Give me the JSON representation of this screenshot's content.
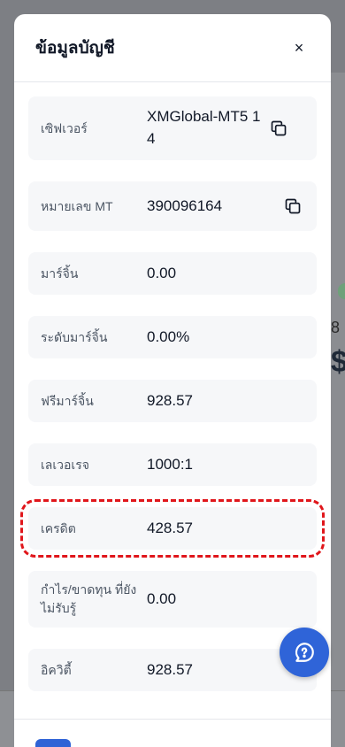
{
  "modal": {
    "title": "ข้อมูลบัญชี",
    "close_label": "×"
  },
  "rows": [
    {
      "label": "เซิฟเวอร์",
      "value": "XMGlobal-MT5 14",
      "copy": true
    },
    {
      "label": "หมายเลข MT",
      "value": "390096164",
      "copy": true
    },
    {
      "label": "มาร์จิ้น",
      "value": "0.00",
      "copy": false
    },
    {
      "label": "ระดับมาร์จิ้น",
      "value": "0.00%",
      "copy": false
    },
    {
      "label": "ฟรีมาร์จิ้น",
      "value": "928.57",
      "copy": false
    },
    {
      "label": "เลเวอเรจ",
      "value": "1000:1",
      "copy": false
    },
    {
      "label": "เครดิต",
      "value": "428.57",
      "copy": false
    },
    {
      "label": "กำไร/ขาดทุน ที่ยังไม่รับรู้",
      "value": "0.00",
      "copy": false
    },
    {
      "label": "อิควิตี้",
      "value": "928.57",
      "copy": false
    }
  ],
  "background": {
    "right_small_text": "8",
    "right_big_text": "$"
  },
  "icons": {
    "copy": "copy-icon",
    "close": "close-icon",
    "chat": "chat-help-icon"
  },
  "colors": {
    "accent": "#2f64d8",
    "highlight": "#e0161b",
    "row_bg": "#f6f7f9"
  }
}
